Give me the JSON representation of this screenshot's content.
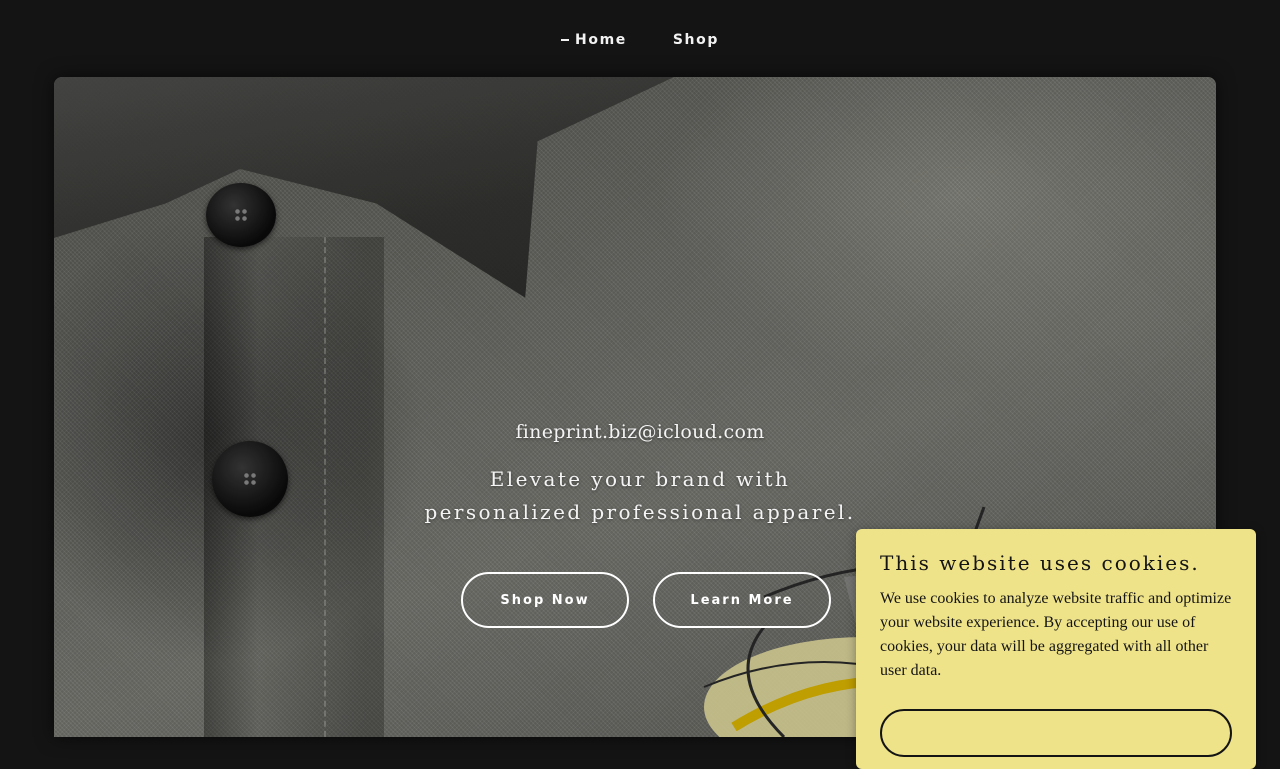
{
  "nav": {
    "items": [
      {
        "label": "Home",
        "active": true
      },
      {
        "label": "Shop",
        "active": false
      }
    ]
  },
  "hero": {
    "email": "fineprint.biz@icloud.com",
    "tagline": "Elevate your brand with personalized professional apparel.",
    "buttons": {
      "shop_now": "Shop Now",
      "learn_more": "Learn More"
    },
    "image_icon": "shirt-photo"
  },
  "cookie_banner": {
    "title": "This website uses cookies.",
    "body": "We use cookies to analyze website traffic and optimize your website experience. By accepting our use of cookies, your data will be aggregated with all other user data.",
    "background": "#efe38a"
  },
  "colors": {
    "page_bg": "#141414",
    "nav_text": "#f2f2f2",
    "hero_text": "#ffffff"
  }
}
